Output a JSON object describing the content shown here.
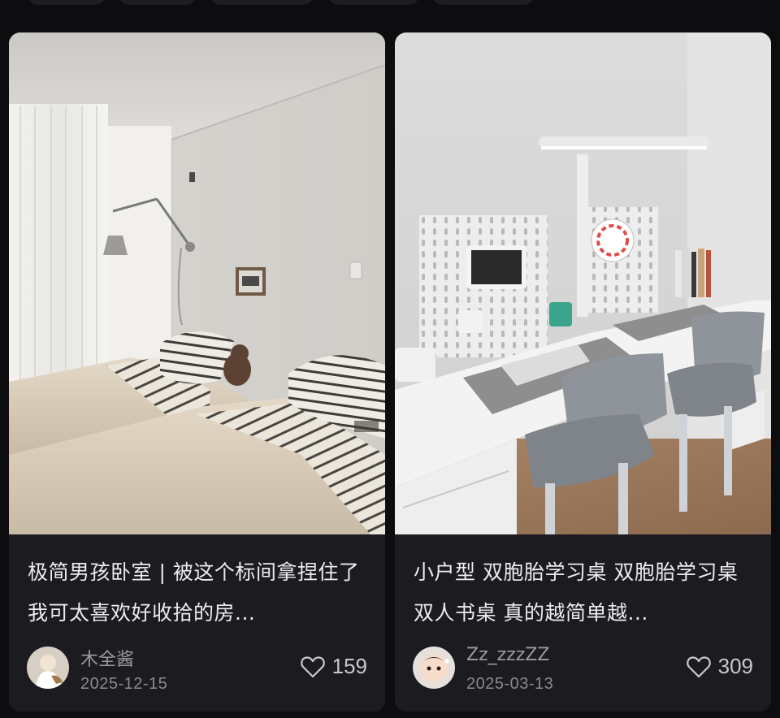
{
  "feed": {
    "cards": [
      {
        "title": "极简男孩卧室 | 被这个标间拿捏住了 我可太喜欢好收拾的房...",
        "author": "木全酱",
        "date": "2025-12-15",
        "likes": "159",
        "image": "minimal-twin-bedroom-photo",
        "avatar": "child-avatar-photo"
      },
      {
        "title": "小户型 双胞胎学习桌 双胞胎学习桌 双人书桌 真的越简单越...",
        "author": "Zz_zzzZZ",
        "date": "2025-03-13",
        "likes": "309",
        "image": "twin-study-desk-photo",
        "avatar": "baby-avatar-photo"
      }
    ]
  },
  "colors": {
    "background": "#0d0d0f",
    "card": "#1b1b20",
    "title_text": "#ecebef",
    "meta_text": "#8a8990"
  },
  "icons": {
    "like": "heart-outline-icon"
  }
}
